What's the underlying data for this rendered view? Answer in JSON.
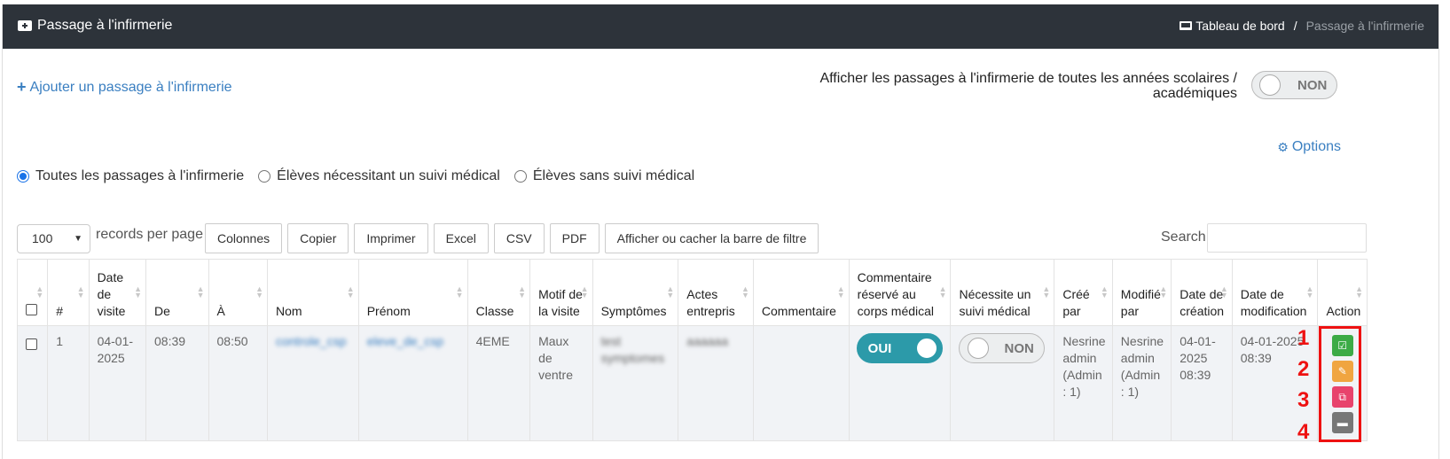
{
  "header": {
    "title": "Passage à l'infirmerie",
    "breadcrumb_home": "Tableau de bord",
    "breadcrumb_sep": "/",
    "breadcrumb_current": "Passage à l'infirmerie"
  },
  "actions": {
    "add_label": "Ajouter un passage à l'infirmerie",
    "all_years_label": "Afficher les passages à l'infirmerie de toutes les années scolaires / académiques",
    "all_years_toggle": "NON",
    "options_label": "Options"
  },
  "filters": {
    "radios": [
      {
        "label": "Toutes les passages à l'infirmerie",
        "checked": true
      },
      {
        "label": "Élèves nécessitant un suivi médical",
        "checked": false
      },
      {
        "label": "Élèves sans suivi médical",
        "checked": false
      }
    ]
  },
  "toolbar": {
    "page_size": "100",
    "records_per_page": "records per page",
    "buttons": [
      "Colonnes",
      "Copier",
      "Imprimer",
      "Excel",
      "CSV",
      "PDF",
      "Afficher ou cacher la barre de filtre"
    ],
    "search_label": "Search:"
  },
  "table": {
    "headers": [
      "#",
      "Date de visite",
      "De",
      "À",
      "Nom",
      "Prénom",
      "Classe",
      "Motif de la visite",
      "Symptômes",
      "Actes entrepris",
      "Commentaire",
      "Commentaire réservé au corps médical",
      "Nécessite un suivi médical",
      "Créé par",
      "Modifié par",
      "Date de création",
      "Date de modification",
      "Action"
    ],
    "row": {
      "num": "1",
      "date_visite": "04-01-2025",
      "de": "08:39",
      "a": "08:50",
      "nom": "controle_csp",
      "prenom": "eleve_de_csp",
      "classe": "4EME",
      "motif": "Maux de ventre",
      "symptomes": "test symptomes",
      "actes": "aaaaaa",
      "commentaire": "",
      "reserve_toggle": "OUI",
      "suivi_toggle": "NON",
      "cree_par": "Nesrine admin (Admin : 1)",
      "modifie_par": "Nesrine admin (Admin : 1)",
      "date_creation": "04-01-2025 08:39",
      "date_modification": "04-01-2025 08:39"
    }
  },
  "annotations": [
    "1",
    "2",
    "3",
    "4"
  ],
  "colors": {
    "header_bg": "#2d333a",
    "link": "#3a7fc1",
    "toggle_on": "#2c9aa9",
    "annotation": "#ee1111",
    "btn_green": "#3cab46",
    "btn_orange": "#f0a540",
    "btn_pink": "#e8436c",
    "btn_gray": "#777777"
  }
}
